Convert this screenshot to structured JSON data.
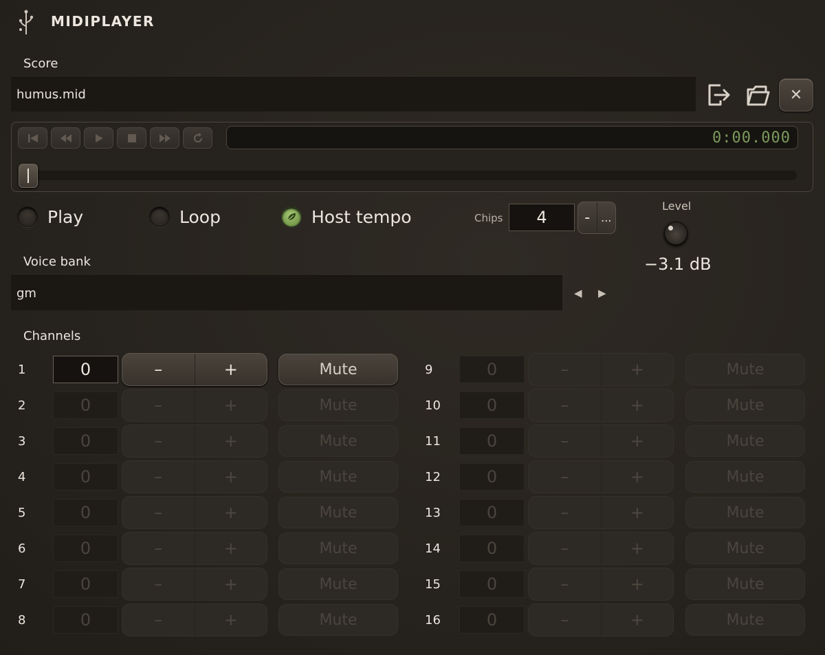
{
  "header": {
    "title": "MIDIPLAYER",
    "logo_icon": "sprout-icon"
  },
  "score": {
    "label": "Score",
    "filename": "humus.mid",
    "export_icon": "export-icon",
    "open_icon": "folder-open-icon",
    "close_icon": "close-icon",
    "close_symbol": "✕"
  },
  "transport": {
    "time": "0:00.000",
    "time_color": "#7c9a5e",
    "position": 0,
    "buttons": [
      "skip-start-icon",
      "rewind-icon",
      "play-icon",
      "stop-icon",
      "fast-forward-icon",
      "loop-icon"
    ]
  },
  "toggles": {
    "play": {
      "label": "Play",
      "on": false
    },
    "loop": {
      "label": "Loop",
      "on": false
    },
    "host_tempo": {
      "label": "Host tempo",
      "on": true
    }
  },
  "chips": {
    "label": "Chips",
    "value": "4",
    "minus": "-",
    "more": "..."
  },
  "level": {
    "label": "Level",
    "value": "−3.1 dB"
  },
  "voice_bank": {
    "label": "Voice bank",
    "value": "gm",
    "prev": "◀",
    "next": "▶"
  },
  "channels": {
    "label": "Channels",
    "minus": "–",
    "plus": "+",
    "mute": "Mute",
    "left": [
      {
        "num": "1",
        "value": "0",
        "active": true
      },
      {
        "num": "2",
        "value": "0",
        "active": false
      },
      {
        "num": "3",
        "value": "0",
        "active": false
      },
      {
        "num": "4",
        "value": "0",
        "active": false
      },
      {
        "num": "5",
        "value": "0",
        "active": false
      },
      {
        "num": "6",
        "value": "0",
        "active": false
      },
      {
        "num": "7",
        "value": "0",
        "active": false
      },
      {
        "num": "8",
        "value": "0",
        "active": false
      }
    ],
    "right": [
      {
        "num": "9",
        "value": "0",
        "active": false
      },
      {
        "num": "10",
        "value": "0",
        "active": false
      },
      {
        "num": "11",
        "value": "0",
        "active": false
      },
      {
        "num": "12",
        "value": "0",
        "active": false
      },
      {
        "num": "13",
        "value": "0",
        "active": false
      },
      {
        "num": "14",
        "value": "0",
        "active": false
      },
      {
        "num": "15",
        "value": "0",
        "active": false
      },
      {
        "num": "16",
        "value": "0",
        "active": false
      }
    ]
  }
}
